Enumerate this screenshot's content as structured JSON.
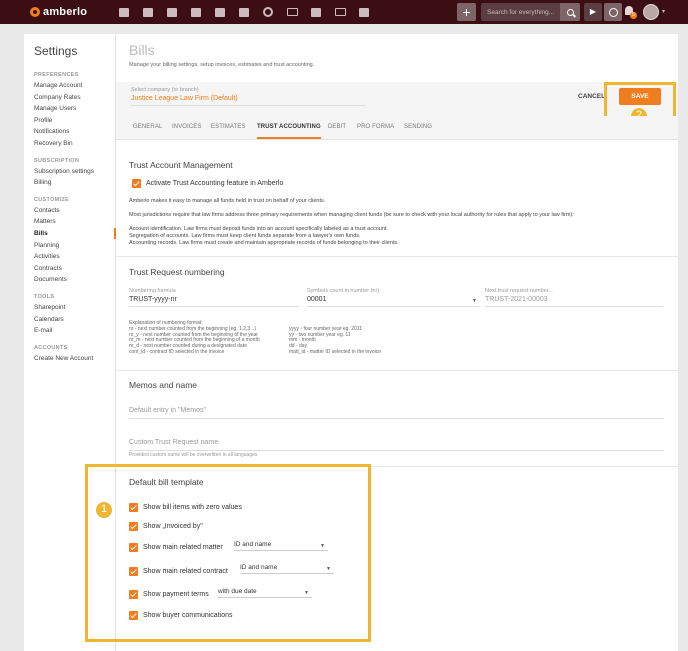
{
  "app": {
    "name": "amberlo"
  },
  "topbar": {
    "search_placeholder": "Search for everything...",
    "plus_label": "+",
    "play_label": "▶",
    "notification_count": "5"
  },
  "sidebar": {
    "title": "Settings",
    "sections": [
      {
        "label": "PREFERENCES",
        "items": [
          "Manage Account",
          "Company Rates",
          "Manage Users",
          "Profile",
          "Notifications",
          "Recovery Bin"
        ]
      },
      {
        "label": "SUBSCRIPTION",
        "items": [
          "Subscription settings",
          "Billing"
        ]
      },
      {
        "label": "CUSTOMIZE",
        "items": [
          "Contacts",
          "Matters",
          "Bills",
          "Planning",
          "Activities",
          "Contracts",
          "Documents"
        ]
      },
      {
        "label": "TOOLS",
        "items": [
          "Sharepoint",
          "Calendars",
          "E-mail"
        ]
      },
      {
        "label": "ACCOUNTS",
        "items": [
          "Create New Account"
        ]
      }
    ],
    "active_item": "Bills"
  },
  "header": {
    "title": "Bills",
    "subtitle": "Manage your billing settings, setup invoices, estimates and trust accounting.",
    "company_label": "Select company (or branch)",
    "company_value": "Justice League Law Firm (Default)",
    "cancel_label": "CANCEL",
    "save_label": "SAVE"
  },
  "tabs": [
    "GENERAL",
    "INVOICES",
    "ESTIMATES",
    "TRUST ACCOUNTING",
    "DEBIT",
    "PRO FORMA",
    "SENDING"
  ],
  "active_tab": "TRUST ACCOUNTING",
  "trust_management": {
    "title": "Trust Account Management",
    "checkbox_label": "Activate Trust Accounting feature in Amberlo",
    "intro": "Amberlo makes it easy to manage all funds held in trust on behalf of your clients.",
    "requirements": "Most jurisdictions require that law firms address three primary requirements when managing client funds (be sure to check with your local authority for rules that apply to your law firm):",
    "points": [
      "Account identification. Law firms must deposit funds into an account specifically labeled as a trust account.",
      "Segregation of accounts. Law firms must keep client funds separate from a lawyer's own funds.",
      "Accounting records. Law firms must create and maintain appropriate records of funds belonging to their clients."
    ]
  },
  "trust_numbering": {
    "title": "Trust Request numbering",
    "formula_label": "Numbering formula",
    "formula_value": "TRUST-yyyy-nr",
    "symbols_label": "Symbols count in number (nr)",
    "symbols_value": "00001",
    "next_label": "Next trust request number...",
    "next_value": "TRUST-2021-00003",
    "explanation_title": "Explanation of numbering format:",
    "explanation_left": [
      "nr - next number counted from the beginning (eg. 1,2,3...)",
      "nr_y - next number counted from the beginning of the year",
      "nr_m - next number counted from the beginning of a month",
      "nr_d - next number counted during a designated date",
      "cont_id - contract ID selected in the invoice"
    ],
    "explanation_right": [
      "yyyy - four number year eg. 2011",
      "yy - two number year eg. 11",
      "mm - month",
      "dd - day",
      "matt_id - matter ID selected in the invoice"
    ]
  },
  "memos": {
    "title": "Memos and name",
    "memo_placeholder": "Default entry in \"Memos\"",
    "name_placeholder": "Custom Trust Request name",
    "name_hint": "Provided custom name will be overwritten in all languages"
  },
  "bill_template": {
    "title": "Default bill template",
    "options": [
      {
        "label": "Show bill items with zero values"
      },
      {
        "label": "Show „Invoiced by\""
      },
      {
        "label": "Show main related matter",
        "select": "ID and name"
      },
      {
        "label": "Show main related contract",
        "select": "ID and name"
      },
      {
        "label": "Show payment terms",
        "select": "with due date"
      },
      {
        "label": "Show buyer communications"
      }
    ]
  },
  "callouts": [
    "1",
    "2"
  ],
  "colors": {
    "accent": "#f07d1e",
    "topbar": "#3a0e12",
    "callout": "#f0b531"
  }
}
